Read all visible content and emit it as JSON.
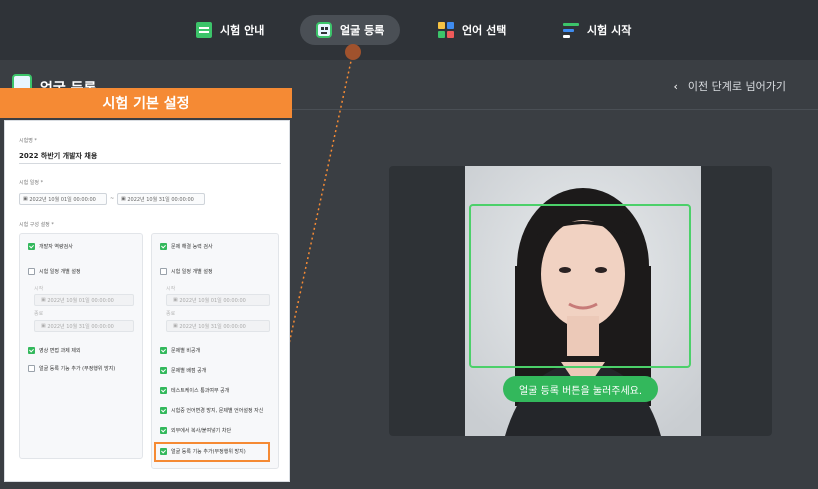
{
  "nav": {
    "items": [
      {
        "label": "시험 안내",
        "icon": "checklist-icon",
        "active": false
      },
      {
        "label": "얼굴 등록",
        "icon": "face-icon",
        "active": true
      },
      {
        "label": "언어 선택",
        "icon": "grid-icon",
        "active": false
      },
      {
        "label": "시험 시작",
        "icon": "list-icon",
        "active": false
      }
    ]
  },
  "header": {
    "title": "얼굴 등록",
    "back_label": "이전 단계로 넘어가기",
    "back_icon": "chevron-left-icon"
  },
  "camera": {
    "hint": "얼굴 등록 버튼을 눌러주세요."
  },
  "overlay": {
    "banner": "시험 기본 설정",
    "exam_name_label": "시험명 *",
    "exam_name": "2022 하반기 개발자 채용",
    "exam_date_label": "시험 일정 *",
    "date_start": "2022년 10월 01일 00:00:00",
    "date_sep": "~",
    "date_end": "2022년 10월 31일 00:00:00",
    "config_label": "시험 구성 설정 *",
    "left": {
      "opt1": "개발자 역량검사",
      "opt2": "시험 일정 개별 설정",
      "start_label": "시작",
      "start_date": "2022년 10월 01일 00:00:00",
      "end_label": "종료",
      "end_date": "2022년 10월 31일 00:00:00",
      "opt3": "영상 면접 과제 제외",
      "opt4": "얼굴 등록 기능 추가 (부정행위 방지)"
    },
    "right": {
      "opt1": "문제 해결 능력 검사",
      "opt2": "시험 일정 개별 설정",
      "start_label": "시작",
      "start_date": "2022년 10월 01일 00:00:00",
      "end_label": "종료",
      "end_date": "2022년 10월 31일 00:00:00",
      "opt3": "문제별 비공개",
      "opt4": "문제별 배점 공개",
      "opt5": "테스트케이스 통과여부 공개",
      "opt6": "시험중 언어변경 방지, 문제별 언어설정 자신",
      "opt7": "외부에서 복사/붙여넣기 차단",
      "opt8": "얼굴 등록 기능 추가(부정행위 방지)"
    }
  },
  "colors": {
    "accent_green": "#33b85c",
    "banner_orange": "#f58a34",
    "topbar": "#2f3338",
    "main_bg": "#3a3e43"
  }
}
